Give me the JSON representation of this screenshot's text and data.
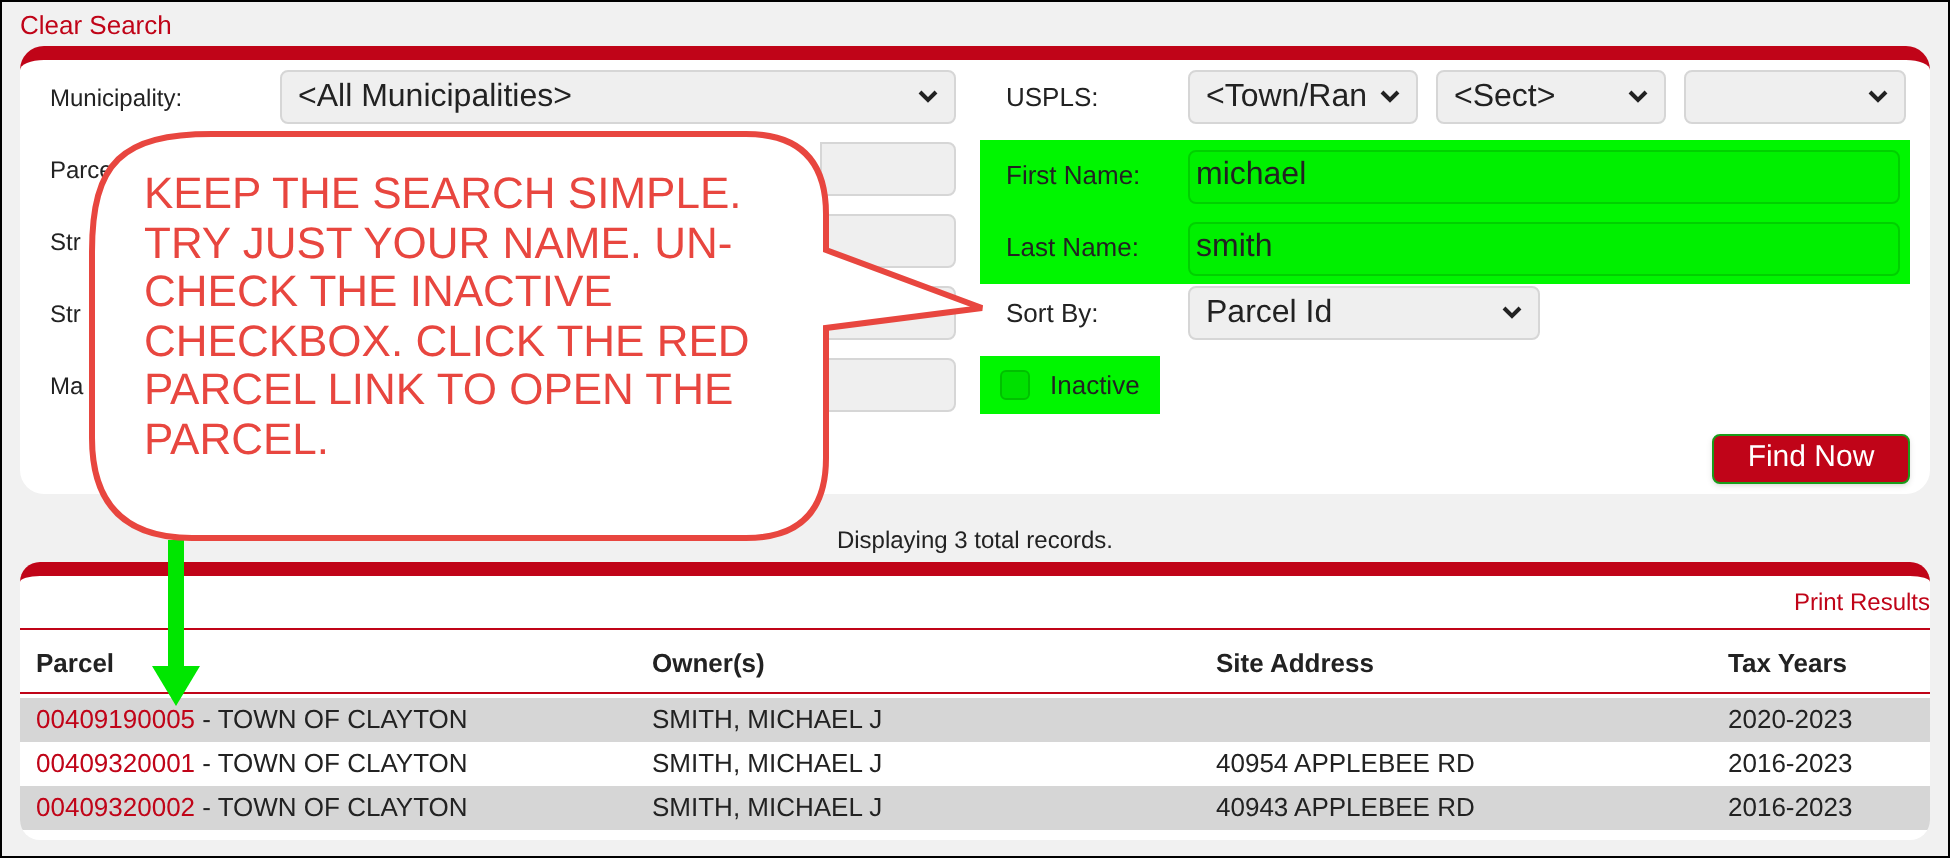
{
  "clear_search": "Clear Search",
  "search_form": {
    "left_fields": [
      {
        "label": "Municipality:",
        "kind": "select",
        "value": "<All Municipalities>"
      },
      {
        "label": "Parce",
        "kind": "text"
      },
      {
        "label": "Str",
        "kind": "text"
      },
      {
        "label": "Str",
        "kind": "text"
      },
      {
        "label": "Ma",
        "kind": "text"
      }
    ],
    "uspls": {
      "label": "USPLS:",
      "selects": [
        {
          "kind": "value",
          "value": "<Town/Ran"
        },
        {
          "kind": "value",
          "value": "<Sect>"
        },
        {
          "kind": "blank"
        }
      ]
    },
    "name_fields": [
      {
        "label": "First Name:",
        "value": "michael",
        "highlighted": true
      },
      {
        "label": "Last Name:",
        "value": "smith",
        "highlighted": true
      }
    ],
    "sort_by": {
      "label": "Sort By:",
      "value": "Parcel Id"
    },
    "inactive": {
      "label": "Inactive",
      "checked": false,
      "highlighted": true
    },
    "find_button": "Find Now"
  },
  "callout": {
    "text": "KEEP THE SEARCH SIMPLE. TRY JUST YOUR NAME. UN-CHECK THE INACTIVE CHECKBOX. CLICK THE RED PARCEL LINK TO OPEN THE PARCEL."
  },
  "record_count": "Displaying 3 total records.",
  "results": {
    "print_link": "Print Results",
    "columns": [
      "Parcel",
      "Owner(s)",
      "Site Address",
      "Tax Years"
    ],
    "rows": [
      {
        "parcel_id": "00409190005",
        "municipality": " - TOWN OF CLAYTON",
        "owner": "SMITH, MICHAEL J",
        "tax_years": "2020-2023"
      },
      {
        "parcel_id": "00409320001",
        "municipality": " - TOWN OF CLAYTON",
        "owner": "SMITH, MICHAEL J",
        "site_address": "40954 APPLEBEE RD",
        "tax_years": "2016-2023"
      },
      {
        "parcel_id": "00409320002",
        "municipality": " - TOWN OF CLAYTON",
        "owner": "SMITH, MICHAEL J",
        "site_address": "40943 APPLEBEE RD",
        "tax_years": "2016-2023"
      }
    ]
  }
}
